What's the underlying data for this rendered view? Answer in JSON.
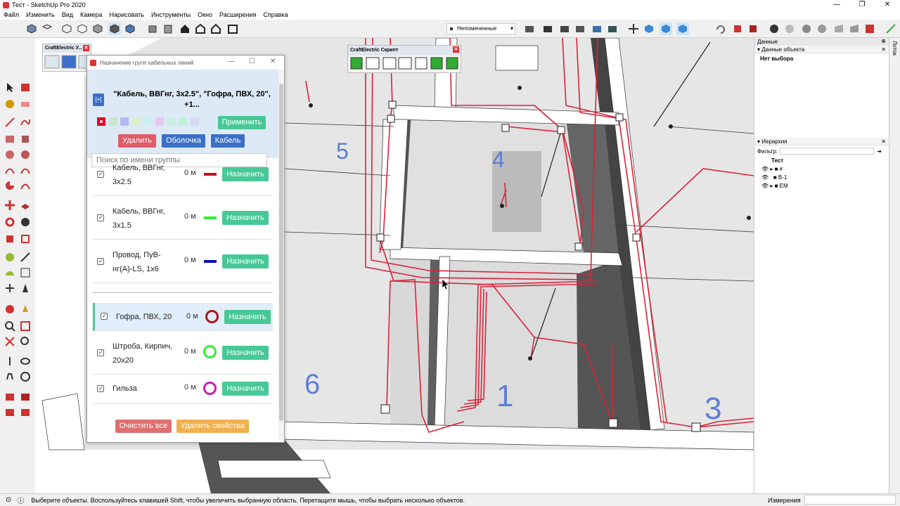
{
  "window": {
    "title": "Тест - SketchUp Pro 2020",
    "controls": [
      "—",
      "❐",
      "✕"
    ]
  },
  "menu": [
    "Файл",
    "Изменить",
    "Вид",
    "Камера",
    "Нарисовать",
    "Инструменты",
    "Окно",
    "Расширения",
    "Справка"
  ],
  "layer_dropdown": {
    "value": "Непомеченные"
  },
  "craftelectric_palette": {
    "title": "CraftElectric У..."
  },
  "script_palette": {
    "title": "CraftElectric Скрипт"
  },
  "dialog": {
    "title": "Назначение групп кабельных линий",
    "plus_label": "[+]",
    "group_title": "\"Кабель, ВВГнг, 3x2.5\", \"Гофра, ПВХ, 20\", +1...",
    "swatch_colors": [
      "#e4002b",
      "#c8e8c8",
      "#b0b8f0",
      "#d8f0c8",
      "#c8f0f0",
      "#e8c8f0",
      "#c8f0e0",
      "#c0f0d8",
      "#d8d8f8"
    ],
    "apply_label": "Применить",
    "delete_label": "Удалить",
    "sheath_label": "Оболочка",
    "cable_label": "Кабель",
    "search_placeholder": "Поиск по имени группы",
    "rows": [
      {
        "name": "Кабель, ВВГнг, 3x2.5",
        "length": "0 м",
        "color": "#cc1122",
        "assign": "Назначить"
      },
      {
        "name": "Кабель, ВВГнг, 3x1.5",
        "length": "0 м",
        "color": "#33ee33",
        "assign": "Назначить"
      },
      {
        "name": "Провод, ПуВ-нг(А)-LS, 1x6",
        "length": "0 м",
        "color": "#0a14b4",
        "assign": "Назначить"
      },
      {
        "name": "Гофра, ПВХ, 20",
        "length": "0 м",
        "color": "#b01414",
        "assign": "Назначить"
      },
      {
        "name": "Штроба, Кирпич, 20x20",
        "length": "0 м",
        "color": "#33ee33",
        "assign": "Назначить"
      },
      {
        "name": "Гильза",
        "length": "0 м",
        "color": "#c81eb4",
        "assign": "Назначить"
      }
    ],
    "clear_all_label": "Очистить все",
    "delete_props_label": "Удалить свойства"
  },
  "model": {
    "room_labels": [
      "5",
      "4",
      "6",
      "1",
      "3"
    ]
  },
  "right_panel": {
    "title": "Данные",
    "entity_info": "Данные объекта",
    "no_selection": "Нет выбора",
    "hierarchy": "Иерархия",
    "filter_label": "Фильтр:",
    "tree": [
      "Тест",
      "#",
      "В-1",
      "ЕМ"
    ]
  },
  "side_tab": "Лоток",
  "status": {
    "text": "Выберите объекты. Воспользуйтесь клавишей Shift, чтобы увеличить выбранную область. Перетащите мышь, чтобы выбрать несколько объектов.",
    "measure_label": "Измерения"
  }
}
